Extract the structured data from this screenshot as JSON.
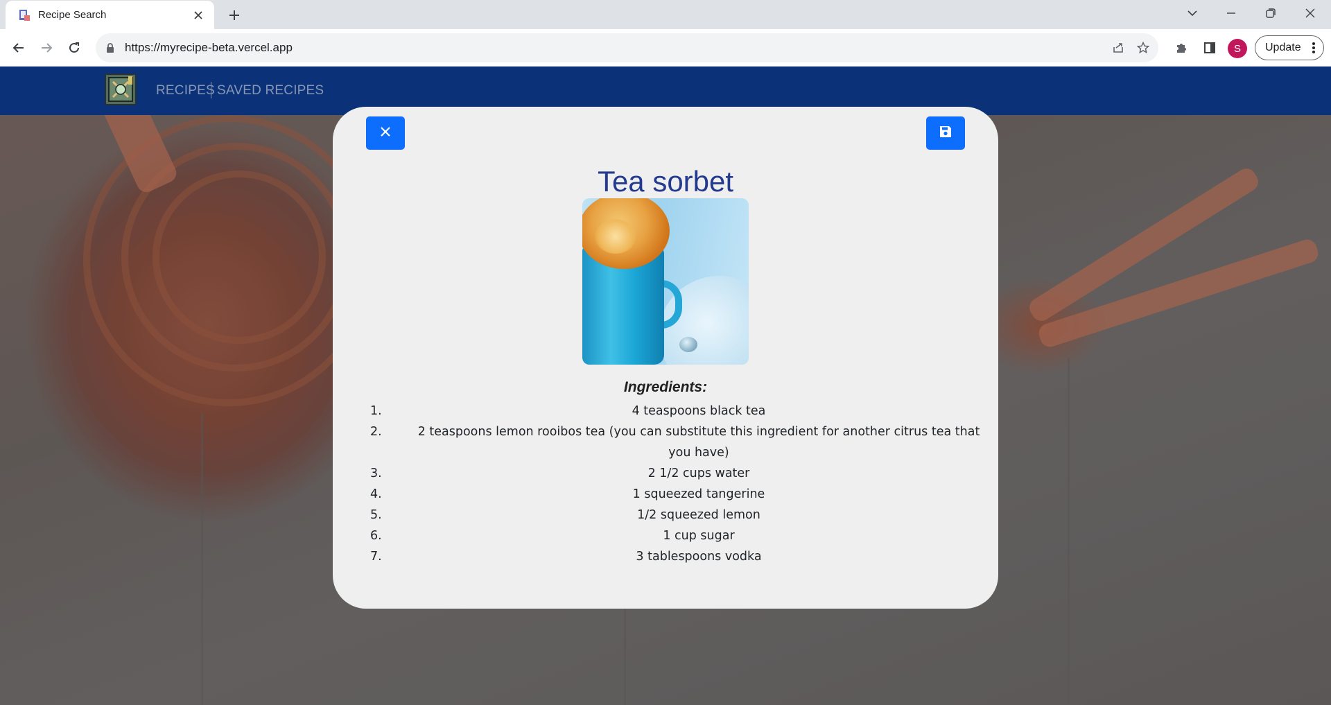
{
  "browser": {
    "tab_title": "Recipe Search",
    "url": "https://myrecipe-beta.vercel.app",
    "profile_initial": "S",
    "update_label": "Update"
  },
  "navbar": {
    "links": [
      "RECIPES",
      "SAVED RECIPES"
    ]
  },
  "modal": {
    "title": "Tea sorbet",
    "ingredients_heading": "Ingredients:",
    "ingredients": [
      "4 teaspoons black tea",
      "2 teaspoons lemon rooibos tea (you can substitute this ingredient for another citrus tea that you have)",
      "2 1/2 cups water",
      "1 squeezed tangerine",
      "1/2 squeezed lemon",
      "1 cup sugar",
      "3 tablespoons vodka"
    ],
    "ingredient_numbers": [
      "1.",
      "2.",
      "3.",
      "4.",
      "5.",
      "6.",
      "7."
    ]
  },
  "colors": {
    "navbar": "#0d3a8a",
    "accent_button": "#0d6efd",
    "title": "#233a8f",
    "modal_bg": "#efefef"
  },
  "icons": {
    "close": "close-icon",
    "save": "floppy-disk-icon"
  }
}
